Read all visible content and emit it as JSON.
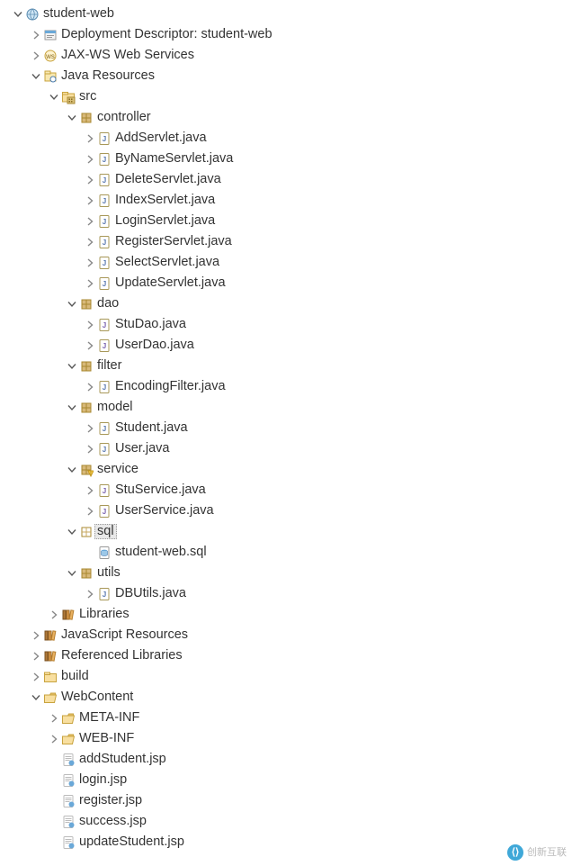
{
  "tree": [
    {
      "indent": 0,
      "twisty": "down",
      "icon": "web-project",
      "text": "student-web"
    },
    {
      "indent": 1,
      "twisty": "right",
      "icon": "deploy-desc",
      "text": "Deployment Descriptor: student-web"
    },
    {
      "indent": 1,
      "twisty": "right",
      "icon": "jaxws",
      "text": "JAX-WS Web Services"
    },
    {
      "indent": 1,
      "twisty": "down",
      "icon": "java-res",
      "text": "Java Resources"
    },
    {
      "indent": 2,
      "twisty": "down",
      "icon": "src-folder",
      "text": "src"
    },
    {
      "indent": 3,
      "twisty": "down",
      "icon": "package",
      "text": "controller"
    },
    {
      "indent": 4,
      "twisty": "right",
      "icon": "java-file",
      "text": "AddServlet.java"
    },
    {
      "indent": 4,
      "twisty": "right",
      "icon": "java-file",
      "text": "ByNameServlet.java"
    },
    {
      "indent": 4,
      "twisty": "right",
      "icon": "java-file",
      "text": "DeleteServlet.java"
    },
    {
      "indent": 4,
      "twisty": "right",
      "icon": "java-file",
      "text": "IndexServlet.java"
    },
    {
      "indent": 4,
      "twisty": "right",
      "icon": "java-file",
      "text": "LoginServlet.java"
    },
    {
      "indent": 4,
      "twisty": "right",
      "icon": "java-file",
      "text": "RegisterServlet.java"
    },
    {
      "indent": 4,
      "twisty": "right",
      "icon": "java-file",
      "text": "SelectServlet.java"
    },
    {
      "indent": 4,
      "twisty": "right",
      "icon": "java-file",
      "text": "UpdateServlet.java"
    },
    {
      "indent": 3,
      "twisty": "down",
      "icon": "package",
      "text": "dao"
    },
    {
      "indent": 4,
      "twisty": "right",
      "icon": "java-interface",
      "text": "StuDao.java"
    },
    {
      "indent": 4,
      "twisty": "right",
      "icon": "java-interface",
      "text": "UserDao.java"
    },
    {
      "indent": 3,
      "twisty": "down",
      "icon": "package",
      "text": "filter"
    },
    {
      "indent": 4,
      "twisty": "right",
      "icon": "java-file",
      "text": "EncodingFilter.java"
    },
    {
      "indent": 3,
      "twisty": "down",
      "icon": "package",
      "text": "model"
    },
    {
      "indent": 4,
      "twisty": "right",
      "icon": "java-file",
      "text": "Student.java"
    },
    {
      "indent": 4,
      "twisty": "right",
      "icon": "java-file",
      "text": "User.java"
    },
    {
      "indent": 3,
      "twisty": "down",
      "icon": "package-warn",
      "text": "service"
    },
    {
      "indent": 4,
      "twisty": "right",
      "icon": "java-interface",
      "text": "StuService.java"
    },
    {
      "indent": 4,
      "twisty": "right",
      "icon": "java-interface",
      "text": "UserService.java"
    },
    {
      "indent": 3,
      "twisty": "down",
      "icon": "package-empty",
      "text": "sql",
      "selected": true
    },
    {
      "indent": 4,
      "twisty": "none",
      "icon": "sql-file",
      "text": "student-web.sql"
    },
    {
      "indent": 3,
      "twisty": "down",
      "icon": "package",
      "text": "utils"
    },
    {
      "indent": 4,
      "twisty": "right",
      "icon": "java-file",
      "text": "DBUtils.java"
    },
    {
      "indent": 2,
      "twisty": "right",
      "icon": "libraries",
      "text": "Libraries"
    },
    {
      "indent": 1,
      "twisty": "right",
      "icon": "libraries",
      "text": "JavaScript Resources"
    },
    {
      "indent": 1,
      "twisty": "right",
      "icon": "libraries",
      "text": "Referenced Libraries"
    },
    {
      "indent": 1,
      "twisty": "right",
      "icon": "folder",
      "text": "build"
    },
    {
      "indent": 1,
      "twisty": "down",
      "icon": "folder-open",
      "text": "WebContent"
    },
    {
      "indent": 2,
      "twisty": "right",
      "icon": "folder-open",
      "text": "META-INF"
    },
    {
      "indent": 2,
      "twisty": "right",
      "icon": "folder-open",
      "text": "WEB-INF"
    },
    {
      "indent": 2,
      "twisty": "none",
      "icon": "jsp-file",
      "text": "addStudent.jsp"
    },
    {
      "indent": 2,
      "twisty": "none",
      "icon": "jsp-file",
      "text": "login.jsp"
    },
    {
      "indent": 2,
      "twisty": "none",
      "icon": "jsp-file",
      "text": "register.jsp"
    },
    {
      "indent": 2,
      "twisty": "none",
      "icon": "jsp-file",
      "text": "success.jsp"
    },
    {
      "indent": 2,
      "twisty": "none",
      "icon": "jsp-file",
      "text": "updateStudent.jsp"
    }
  ],
  "watermark": "创新互联"
}
